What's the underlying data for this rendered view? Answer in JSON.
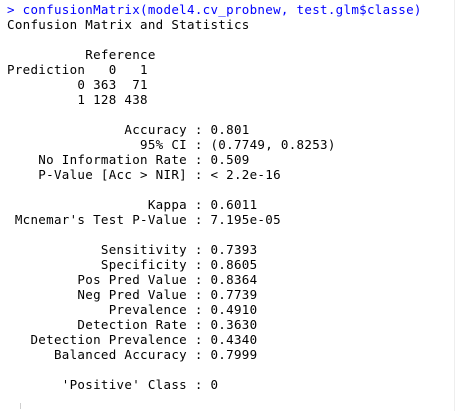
{
  "console": {
    "command": "> confusionMatrix(model4.cv_probnew, test.glm$classe)",
    "heading": "Confusion Matrix and Statistics",
    "matrix": {
      "reference_header": "          Reference",
      "column_header": "Prediction   0   1",
      "row_0": "         0 363  71",
      "row_1": "         1 128 438"
    },
    "stats_block_1": [
      "               Accuracy : 0.801",
      "                 95% CI : (0.7749, 0.8253)",
      "    No Information Rate : 0.509",
      "    P-Value [Acc > NIR] : < 2.2e-16"
    ],
    "stats_block_2": [
      "                  Kappa : 0.6011",
      " Mcnemar's Test P-Value : 7.195e-05"
    ],
    "stats_block_3": [
      "            Sensitivity : 0.7393",
      "            Specificity : 0.8605",
      "         Pos Pred Value : 0.8364",
      "         Neg Pred Value : 0.7739",
      "             Prevalence : 0.4910",
      "         Detection Rate : 0.3630",
      "   Detection Prevalence : 0.4340",
      "      Balanced Accuracy : 0.7999"
    ],
    "positive_class": "       'Positive' Class : 0"
  },
  "colors": {
    "command_text": "#0000ff",
    "output_text": "#000000",
    "background": "#ffffff"
  }
}
